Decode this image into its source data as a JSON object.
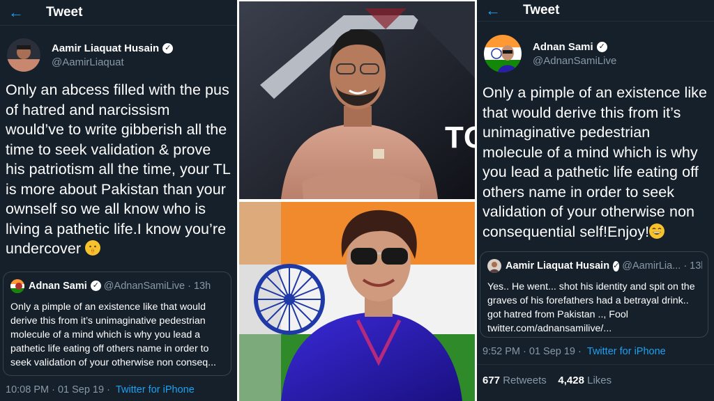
{
  "left": {
    "header": {
      "back_icon": "back-arrow-icon",
      "title": "Tweet"
    },
    "author": {
      "name": "Aamir Liaquat Husain",
      "handle": "@AamirLiaquat"
    },
    "text": "Only an abcess filled with the pus of hatred and narcissism would’ve  to write gibberish all the time to seek validation & prove his patriotism all the time, your TL is more about Pakistan than your ownself so we all know who is living a pathetic life.I know you’re undercover",
    "emoji": "shushing-face",
    "quote": {
      "name": "Adnan Sami",
      "handle": "@AdnanSamiLive",
      "time": "· 13h",
      "text": "Only a pimple of an existence like that would derive this from it’s unimaginative pedestrian molecule of a mind which is why you lead a pathetic life eating off others name in order to seek validation of your otherwise non conseq..."
    },
    "meta": {
      "datetime": "10:08 PM · 01 Sep 19 ·",
      "source": "Twitter for iPhone"
    }
  },
  "right": {
    "header": {
      "back_icon": "back-arrow-icon",
      "title": "Tweet"
    },
    "author": {
      "name": "Adnan Sami",
      "handle": "@AdnanSamiLive"
    },
    "text": "Only a pimple of an existence like that would derive this from it’s unimaginative pedestrian molecule of a mind which is why you lead a pathetic life eating off others name in order to seek validation of your otherwise non consequential self!Enjoy!",
    "emoji": "grinning-face",
    "quote": {
      "name": "Aamir Liaquat Husain",
      "handle": "@AamirLia...",
      "time": "· 13h",
      "text": "Yes.. He went... shot his identity and spit on the graves of his forefathers had a betrayal drink.. got hatred from Pakistan .., Fool twitter.com/adnansamilive/..."
    },
    "meta": {
      "datetime": "9:52 PM · 01 Sep 19 ·",
      "source": "Twitter for iPhone"
    },
    "stats": {
      "retweets": "677",
      "retweets_label": "Retweets",
      "likes": "4,428",
      "likes_label": "Likes"
    }
  },
  "photos": {
    "top": {
      "subject": "man-in-kurta-photo",
      "backdrop_text": "TC"
    },
    "bottom": {
      "subject": "man-with-sunglasses-india-flag-photo"
    }
  },
  "colors": {
    "tweet_bg": "#15202b",
    "link": "#1da1f2",
    "muted": "#8899a6"
  }
}
